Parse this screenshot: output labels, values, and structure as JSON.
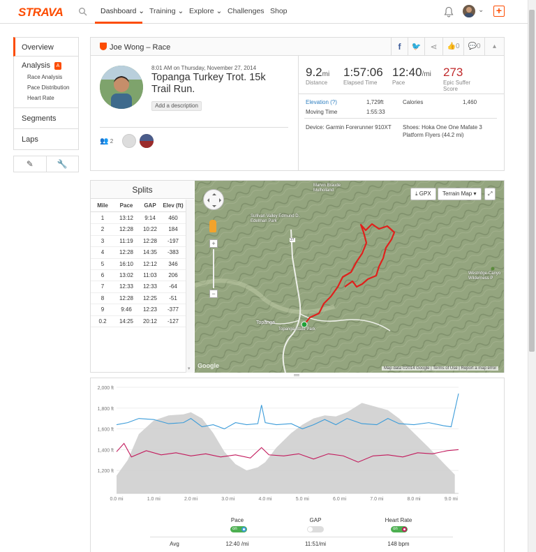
{
  "brand": {
    "logo": "STRAVA"
  },
  "nav": {
    "items": [
      "Dashboard",
      "Training",
      "Explore",
      "Challenges",
      "Shop"
    ]
  },
  "sidebar": {
    "overview": "Overview",
    "analysis": "Analysis",
    "analysis_badge": "A",
    "analysis_items": [
      "Race Analysis",
      "Pace Distribution",
      "Heart Rate"
    ],
    "segments": "Segments",
    "laps": "Laps"
  },
  "activity": {
    "athlete_title": "Joe Wong – Race",
    "date": "8:01 AM on Thursday, November 27, 2014",
    "title": "Topanga Turkey Trot. 15k Trail Run.",
    "add_description": "Add a description",
    "kudos_count": "2",
    "like_count": "0",
    "comment_count": "0",
    "stats": {
      "distance": "9.2",
      "distance_unit": "mi",
      "distance_label": "Distance",
      "elapsed": "1:57:06",
      "elapsed_label": "Elapsed Time",
      "pace": "12:40",
      "pace_unit": "/mi",
      "pace_label": "Pace",
      "suffer": "273",
      "suffer_label1": "Epic Suffer",
      "suffer_label2": "Score",
      "elevation_label": "Elevation (?)",
      "elevation": "1,729ft",
      "calories_label": "Calories",
      "calories": "1,460",
      "moving_label": "Moving Time",
      "moving": "1:55:33",
      "device": "Device: Garmin Forerunner 910XT",
      "shoes1": "Shoes: Hoka One One Mafate 3",
      "shoes2": "Platform Flyers (44.2 mi)"
    }
  },
  "splits": {
    "title": "Splits",
    "columns": [
      "Mile",
      "Pace",
      "GAP",
      "Elev (ft)"
    ],
    "rows": [
      [
        "1",
        "13:12",
        "9:14",
        "460"
      ],
      [
        "2",
        "12:28",
        "10:22",
        "184"
      ],
      [
        "3",
        "11:19",
        "12:28",
        "-197"
      ],
      [
        "4",
        "12:28",
        "14:35",
        "-383"
      ],
      [
        "5",
        "16:10",
        "12:12",
        "346"
      ],
      [
        "6",
        "13:02",
        "11:03",
        "206"
      ],
      [
        "7",
        "12:33",
        "12:33",
        "-64"
      ],
      [
        "8",
        "12:28",
        "12:25",
        "-51"
      ],
      [
        "9",
        "9:46",
        "12:23",
        "-377"
      ],
      [
        "0.2",
        "14:25",
        "20:12",
        "-127"
      ]
    ]
  },
  "map": {
    "gpx": "GPX",
    "terrain": "Terrain Map",
    "label_park": "Topanga State Park",
    "label_town": "Topanga",
    "label_valley": "Sullivan Valley Edmund D. Edelman Park",
    "label_reserve": "Marvin Braude Mulholland",
    "label_westridge": "Westridge-Canyo Wilderness P",
    "attribution": "Map data ©2014 Google",
    "terms": "Terms of Use",
    "report": "Report a map error",
    "google": "Google",
    "road": "27"
  },
  "chart_data": {
    "type": "line",
    "xlabel": "",
    "ylabel": "",
    "x_ticks": [
      "0.0 mi",
      "1.0 mi",
      "2.0 mi",
      "3.0 mi",
      "4.0 mi",
      "5.0 mi",
      "6.0 mi",
      "7.0 mi",
      "8.0 mi",
      "9.0 mi"
    ],
    "y_ticks": [
      "2,000 ft",
      "1,800 ft",
      "1,600 ft",
      "1,400 ft",
      "1,200 ft"
    ],
    "xlim": [
      0,
      9.2
    ],
    "ylim": [
      1100,
      2000
    ],
    "series": [
      {
        "name": "Elevation",
        "color": "#cccccc",
        "x": [
          0,
          0.3,
          0.6,
          1.0,
          1.4,
          1.8,
          2.0,
          2.3,
          2.6,
          2.9,
          3.2,
          3.5,
          3.8,
          4.0,
          4.3,
          4.7,
          5.0,
          5.3,
          5.6,
          5.9,
          6.2,
          6.6,
          7.0,
          7.3,
          7.6,
          8.0,
          8.4,
          8.8,
          9.1
        ],
        "values": [
          1150,
          1300,
          1550,
          1680,
          1730,
          1740,
          1760,
          1700,
          1560,
          1380,
          1260,
          1200,
          1230,
          1280,
          1420,
          1560,
          1640,
          1700,
          1730,
          1720,
          1760,
          1850,
          1810,
          1780,
          1700,
          1560,
          1420,
          1270,
          1160
        ]
      },
      {
        "name": "Pace",
        "color": "#3a9bd9",
        "x": [
          0,
          0.3,
          0.6,
          1.0,
          1.4,
          1.8,
          2.0,
          2.3,
          2.6,
          2.9,
          3.2,
          3.5,
          3.8,
          3.9,
          4.0,
          4.3,
          4.7,
          5.0,
          5.3,
          5.6,
          5.9,
          6.2,
          6.6,
          7.0,
          7.3,
          7.6,
          8.0,
          8.4,
          8.8,
          9.0,
          9.2
        ],
        "values": [
          1640,
          1660,
          1700,
          1690,
          1650,
          1660,
          1700,
          1620,
          1640,
          1600,
          1660,
          1640,
          1650,
          1830,
          1660,
          1640,
          1650,
          1600,
          1640,
          1690,
          1640,
          1700,
          1650,
          1640,
          1700,
          1650,
          1640,
          1660,
          1630,
          1620,
          1940
        ]
      },
      {
        "name": "Heart Rate",
        "color": "#c2185b",
        "x": [
          0,
          0.2,
          0.4,
          0.8,
          1.2,
          1.6,
          2.0,
          2.4,
          2.8,
          3.2,
          3.6,
          3.9,
          4.1,
          4.5,
          4.9,
          5.3,
          5.7,
          6.1,
          6.5,
          6.9,
          7.3,
          7.7,
          8.1,
          8.5,
          8.9,
          9.2
        ],
        "values": [
          1380,
          1460,
          1330,
          1390,
          1350,
          1370,
          1340,
          1360,
          1330,
          1350,
          1320,
          1420,
          1350,
          1340,
          1360,
          1310,
          1360,
          1340,
          1280,
          1340,
          1350,
          1330,
          1370,
          1360,
          1390,
          1400
        ]
      }
    ]
  },
  "legend": {
    "pace": "Pace",
    "gap": "GAP",
    "heart_rate": "Heart Rate",
    "avg_label": "Avg",
    "avg_pace": "12:40 /mi",
    "avg_gap": "11:51/mi",
    "avg_hr": "148 bpm",
    "on": "on"
  },
  "colors": {
    "brand": "#fc4c02",
    "pace": "#3a9bd9",
    "hr": "#c2185b",
    "elevation": "#cccccc",
    "route": "#e0201c"
  }
}
